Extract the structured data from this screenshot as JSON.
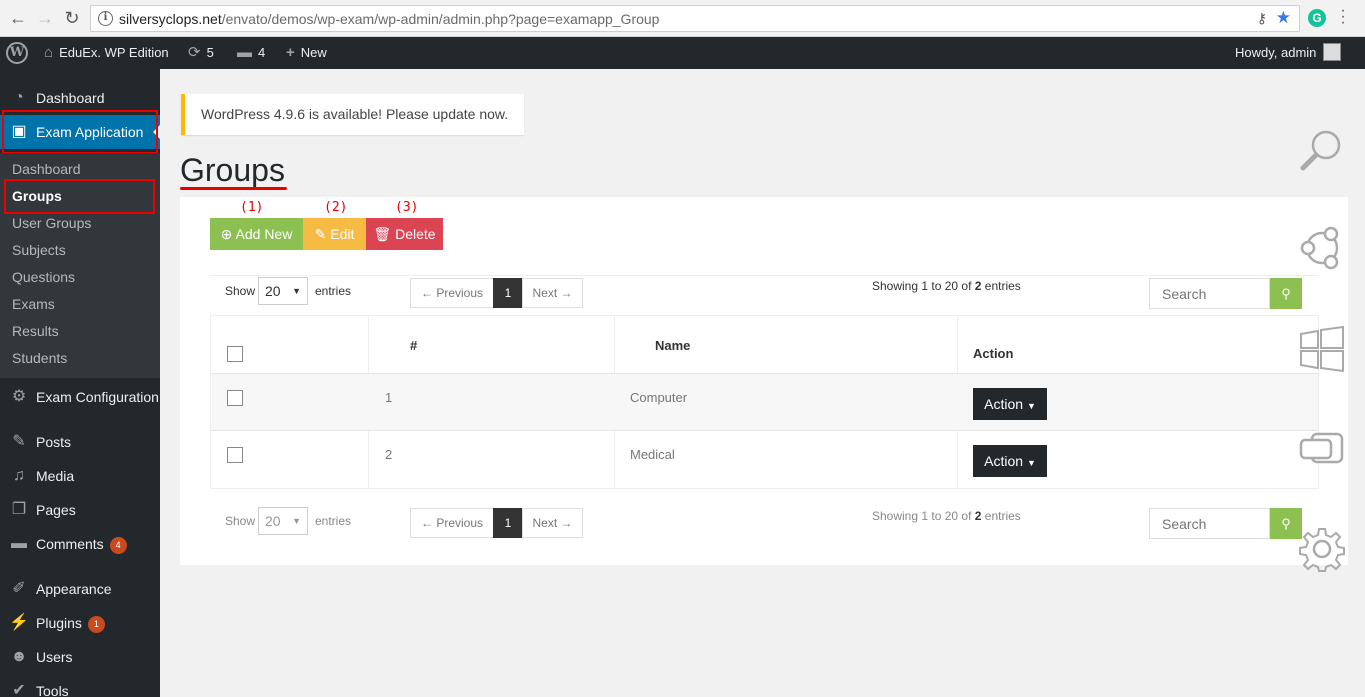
{
  "browser": {
    "url_host": "silversyclops.net",
    "url_path": "/envato/demos/wp-exam/wp-admin/admin.php?page=examapp_Group"
  },
  "admin_bar": {
    "site_name": "EduEx. WP Edition",
    "updates_count": "5",
    "comments_count": "4",
    "new_label": "New",
    "howdy": "Howdy, admin"
  },
  "sidebar": {
    "dashboard": "Dashboard",
    "exam_application": "Exam Application",
    "submenu": [
      "Dashboard",
      "Groups",
      "User Groups",
      "Subjects",
      "Questions",
      "Exams",
      "Results",
      "Students"
    ],
    "exam_configuration": "Exam Configuration",
    "posts": "Posts",
    "media": "Media",
    "pages": "Pages",
    "comments": "Comments",
    "comments_badge": "4",
    "appearance": "Appearance",
    "plugins": "Plugins",
    "plugins_badge": "1",
    "users": "Users",
    "tools": "Tools"
  },
  "notice": "WordPress 4.9.6 is available! Please update now.",
  "page_title": "Groups",
  "toolbar": {
    "add_label": "Add New",
    "edit_label": "Edit",
    "delete_label": "Delete",
    "markers": [
      "(1)",
      "(2)",
      "(3)"
    ]
  },
  "table_controls": {
    "show_label": "Show",
    "entries_label": "entries",
    "page_size": "20",
    "prev_label": "← Previous",
    "current_page": "1",
    "next_label": "Next →",
    "info_prefix": "Showing 1 to 20 of",
    "info_total": "2",
    "info_suffix": "entries",
    "search_placeholder": "Search"
  },
  "table": {
    "headers": [
      "#",
      "Name",
      "Action"
    ],
    "rows": [
      {
        "num": "1",
        "name": "Computer",
        "action": "Action"
      },
      {
        "num": "2",
        "name": "Medical",
        "action": "Action"
      }
    ]
  },
  "colors": {
    "add": "#8cc152",
    "edit": "#f6bb42",
    "delete": "#da4453",
    "wp_active": "#0073aa",
    "highlight": "#ee0000"
  }
}
